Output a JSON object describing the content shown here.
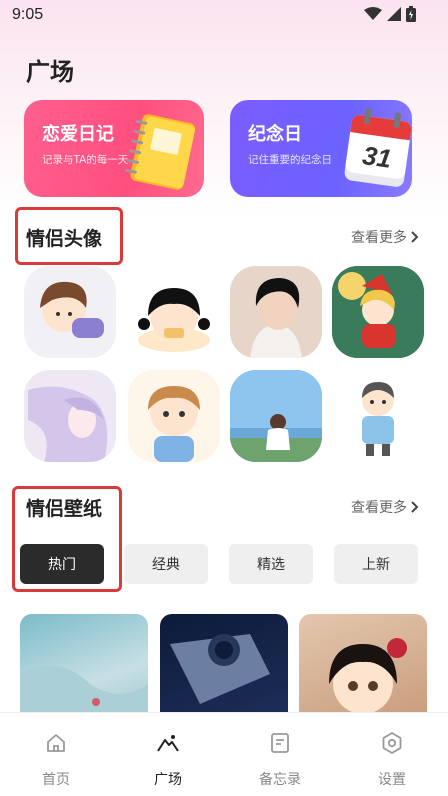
{
  "status_bar": {
    "time": "9:05",
    "icons": [
      "wifi-icon",
      "signal-icon",
      "battery-icon"
    ]
  },
  "page": {
    "title": "广场"
  },
  "feature_cards": [
    {
      "title": "恋爱日记",
      "subtitle": "记录与TA的每一天",
      "icon": "notebook-icon"
    },
    {
      "title": "纪念日",
      "subtitle": "记住重要的纪念日",
      "icon": "calendar-icon",
      "calendar_number": "31"
    }
  ],
  "avatars_section": {
    "title": "情侣头像",
    "more_label": "查看更多",
    "items": [
      "avatar-1",
      "avatar-2",
      "avatar-3",
      "avatar-4",
      "avatar-5",
      "avatar-6",
      "avatar-7",
      "avatar-8"
    ]
  },
  "wallpaper_section": {
    "title": "情侣壁纸",
    "more_label": "查看更多",
    "chips": [
      {
        "label": "热门",
        "active": true
      },
      {
        "label": "经典",
        "active": false
      },
      {
        "label": "精选",
        "active": false
      },
      {
        "label": "上新",
        "active": false
      }
    ]
  },
  "tab_bar": {
    "items": [
      {
        "label": "首页",
        "icon": "home-icon",
        "active": false
      },
      {
        "label": "广场",
        "icon": "mountain-icon",
        "active": true
      },
      {
        "label": "备忘录",
        "icon": "memo-icon",
        "active": false
      },
      {
        "label": "设置",
        "icon": "settings-icon",
        "active": false
      }
    ]
  },
  "colors": {
    "accent_pink": "#ff4f7f",
    "accent_purple": "#6b62ff",
    "highlight_red": "#d93b3b",
    "active_chip": "#2b2b2b"
  }
}
